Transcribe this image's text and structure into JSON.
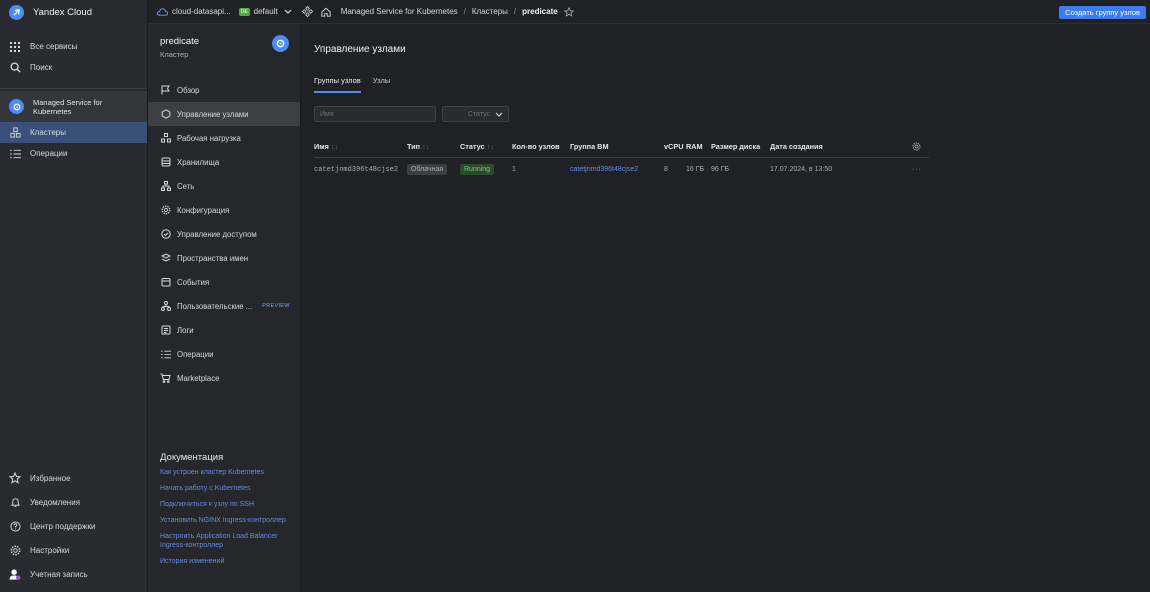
{
  "app": {
    "title": "Yandex Cloud"
  },
  "sidebar": {
    "all_services": "Все сервисы",
    "search": "Поиск",
    "service": "Managed Service for Kubernetes",
    "clusters": "Кластеры",
    "operations": "Операции",
    "bottom": {
      "favorites": "Избранное",
      "notifications": "Уведомления",
      "support": "Центр поддержки",
      "settings": "Настройки",
      "account": "Учетная запись"
    }
  },
  "topbar": {
    "cloud": "cloud-datasapi...",
    "folder_badge": "DE",
    "folder": "default",
    "crumb_service": "Managed Service for Kubernetes",
    "crumb_clusters": "Кластеры",
    "crumb_current": "predicate",
    "create_button": "Создать группу узлов"
  },
  "cluster": {
    "name": "predicate",
    "subtitle": "Кластер",
    "menu": {
      "overview": "Обзор",
      "node_management": "Управление узлами",
      "workload": "Рабочая нагрузка",
      "storage": "Хранилища",
      "network": "Сеть",
      "configuration": "Конфигурация",
      "access": "Управление доступом",
      "namespaces": "Пространства имен",
      "events": "События",
      "custom_resources": "Пользовательские ...",
      "preview": "PREVIEW",
      "logs": "Логи",
      "operations": "Операции",
      "marketplace": "Marketplace"
    }
  },
  "docs": {
    "title": "Документация",
    "links": [
      "Как устроен кластер Kubernetes",
      "Начать работу с Kubernetes",
      "Подключиться к узлу по SSH",
      "Установить NGINX Ingress-контроллер",
      "Настроить Application Load Balancer Ingress-контроллер",
      "История изменений"
    ]
  },
  "main": {
    "title": "Управление узлами",
    "tabs": [
      "Группы узлов",
      "Узлы"
    ],
    "filter": {
      "name_placeholder": "Имя",
      "status_placeholder": "Статус"
    },
    "table": {
      "columns": [
        "Имя",
        "Тип",
        "Статус",
        "Кол-во узлов",
        "Группа ВМ",
        "vCPU",
        "RAM",
        "Размер диска",
        "Дата создания"
      ],
      "rows": [
        {
          "name": "catetjnmd396t48cjse2",
          "type": "Облачная",
          "status": "Running",
          "nodes": "1",
          "vm_group": "catetjnmd396t48cjse2",
          "vcpu": "8",
          "ram": "16 ГБ",
          "disk": "96 ГБ",
          "created": "17.07.2024, в 13:50",
          "more": "···"
        }
      ]
    }
  }
}
